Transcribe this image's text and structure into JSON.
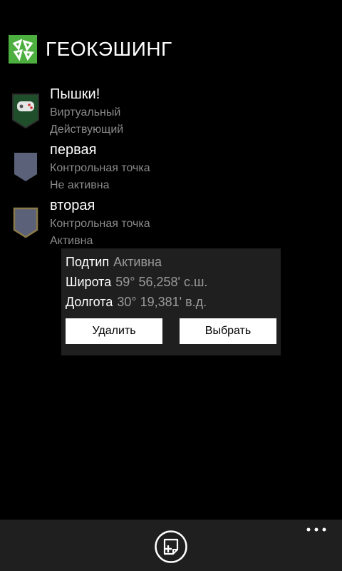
{
  "header": {
    "title": "ГЕОКЭШИНГ",
    "logo_icon": "geocaching-logo-icon",
    "accent": "#4caf3f"
  },
  "list": {
    "items": [
      {
        "title": "Пышки!",
        "line1": "Виртуальный",
        "line2": "Действующий",
        "icon": "gamepad-marker-icon",
        "icon_fill": "#1f4f2a"
      },
      {
        "title": "первая",
        "line1": "Контрольная точка",
        "line2": "Не активна",
        "icon": "waypoint-marker-icon",
        "icon_fill": "#5b6178"
      },
      {
        "title": "вторая",
        "line1": "Контрольная точка",
        "line2": "Активна",
        "icon": "waypoint-marker-active-icon",
        "icon_fill": "#5b6178"
      }
    ]
  },
  "popup": {
    "subtype_label": "Подтип",
    "subtype_value": "Активна",
    "lat_label": "Широта",
    "lat_value": "59° 56,258' с.ш.",
    "lon_label": "Долгота",
    "lon_value": "30° 19,381' в.д.",
    "delete_label": "Удалить",
    "select_label": "Выбрать"
  },
  "appbar": {
    "add_icon": "add-waypoint-icon",
    "more_icon": "more-dots-icon",
    "background": "#1f1f1f"
  }
}
